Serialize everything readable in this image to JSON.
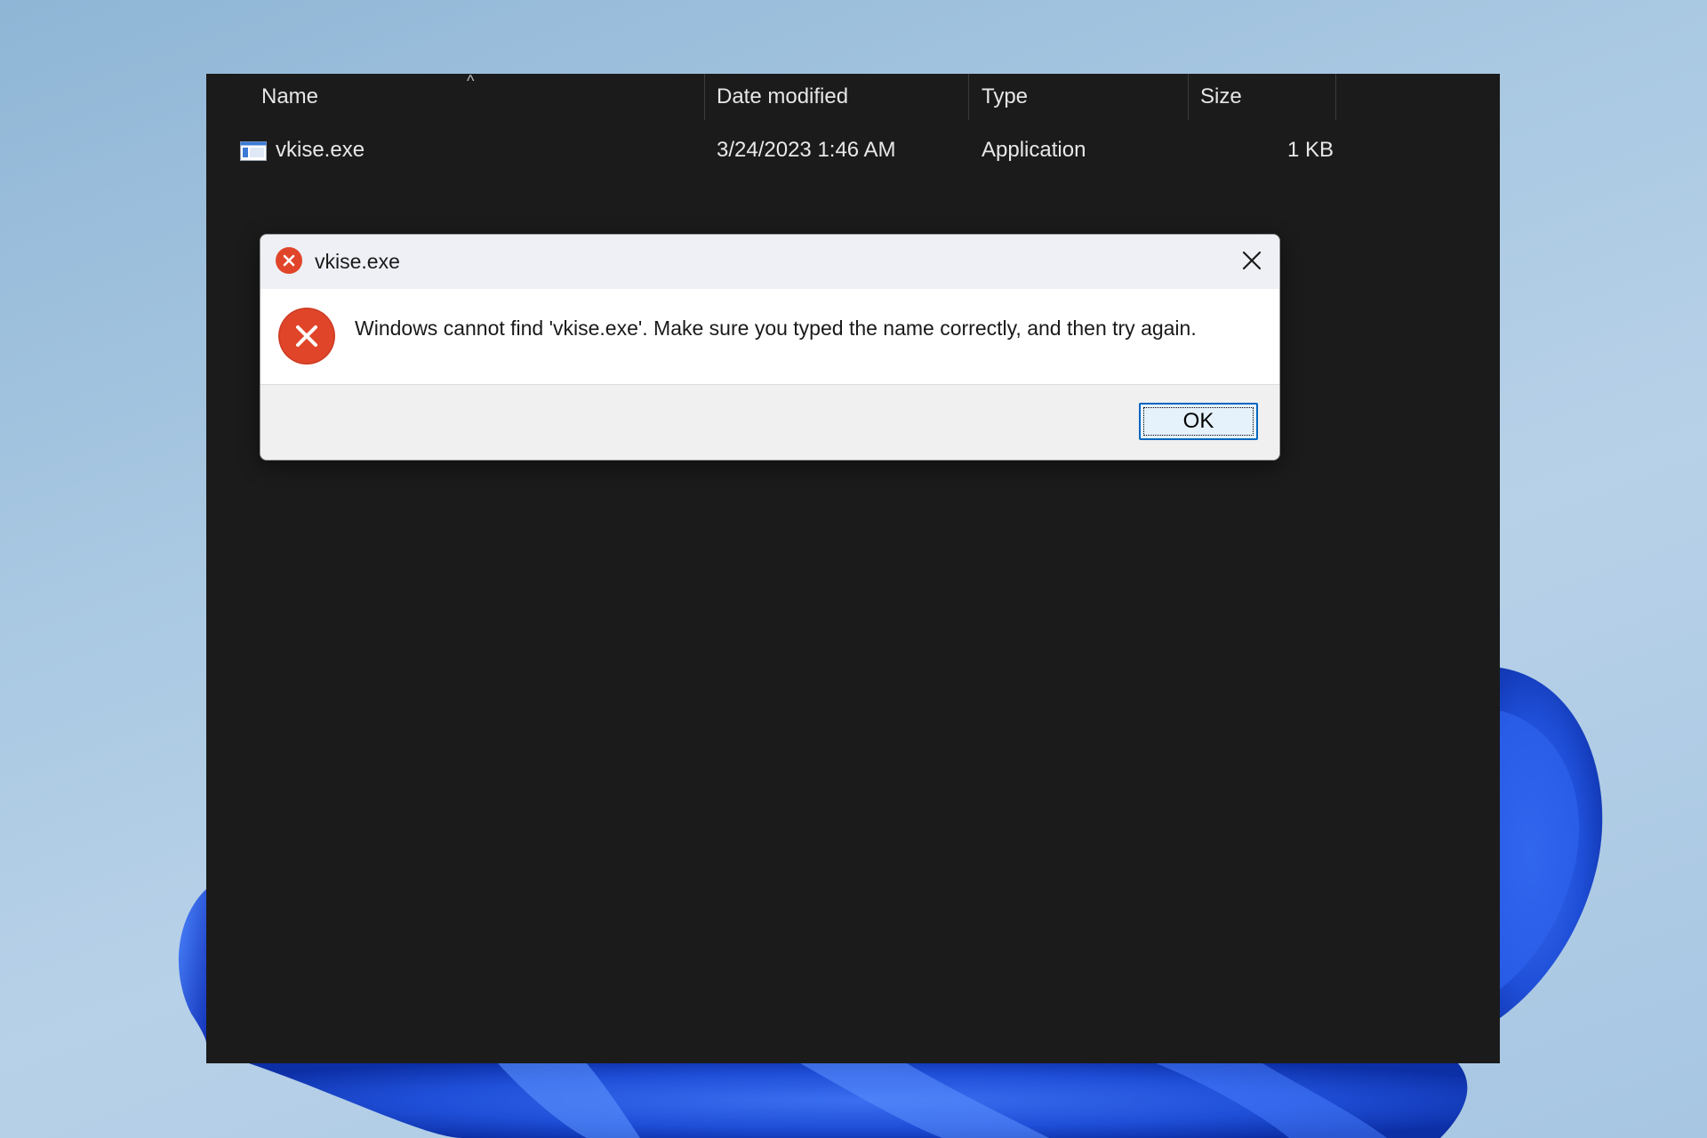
{
  "explorer": {
    "columns": {
      "name": "Name",
      "date_modified": "Date modified",
      "type": "Type",
      "size": "Size"
    },
    "sort_indicator": "^",
    "files": [
      {
        "name": "vkise.exe",
        "date_modified": "3/24/2023 1:46 AM",
        "type": "Application",
        "size": "1 KB",
        "icon": "application-icon"
      }
    ]
  },
  "dialog": {
    "title": "vkise.exe",
    "title_icon": "error-icon",
    "message": "Windows cannot find 'vkise.exe'. Make sure you typed the name correctly, and then try again.",
    "ok_label": "OK",
    "close_icon": "close-icon"
  },
  "colors": {
    "explorer_bg": "#1b1b1b",
    "error_red": "#e0452a",
    "accent_blue": "#0067c0",
    "wallpaper_blue": "#1f4fd8"
  }
}
